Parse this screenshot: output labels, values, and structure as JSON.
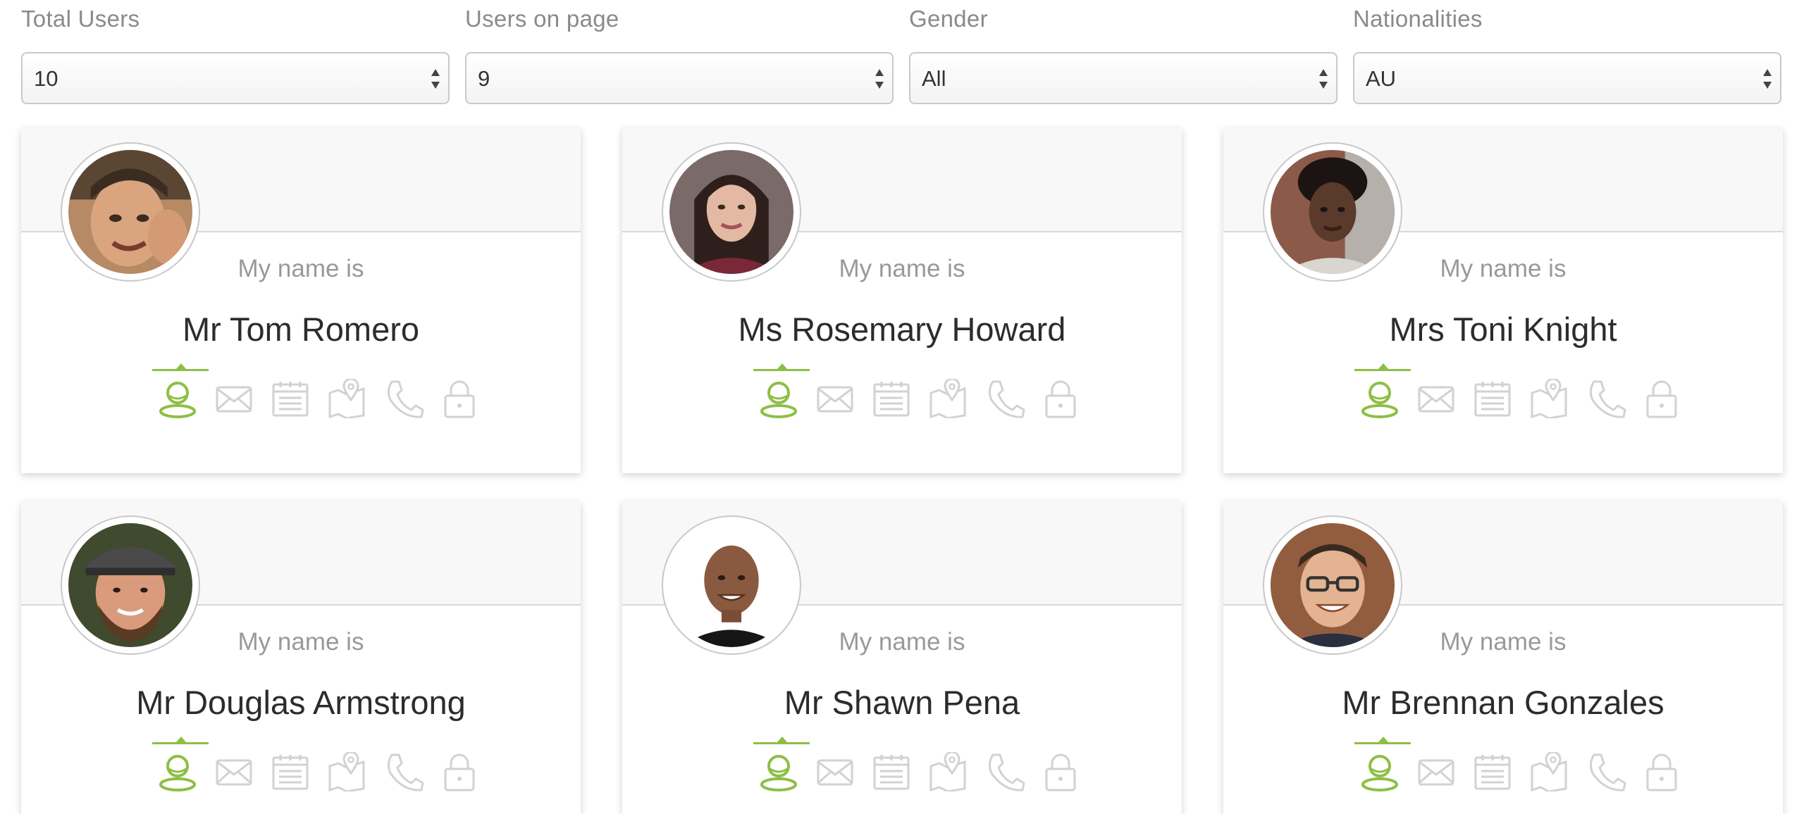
{
  "filters": [
    {
      "label": "Total Users",
      "value": "10"
    },
    {
      "label": "Users on page",
      "value": "9"
    },
    {
      "label": "Gender",
      "value": "All"
    },
    {
      "label": "Nationalities",
      "value": "AU"
    }
  ],
  "card_caption": "My name is",
  "users": [
    {
      "name": "Mr Tom Romero",
      "avatar": "man-avatar"
    },
    {
      "name": "Ms Rosemary Howard",
      "avatar": "woman-avatar"
    },
    {
      "name": "Mrs Toni Knight",
      "avatar": "woman-avatar"
    },
    {
      "name": "Mr Douglas Armstrong",
      "avatar": "man-avatar"
    },
    {
      "name": "Mr Shawn Pena",
      "avatar": "man-avatar"
    },
    {
      "name": "Mr Brennan Gonzales",
      "avatar": "man-avatar"
    }
  ],
  "card_icons": [
    "user-icon",
    "mail-icon",
    "calendar-icon",
    "map-icon",
    "phone-icon",
    "lock-icon"
  ],
  "colors": {
    "accent": "#8dbf45",
    "icon_inactive": "#d2d2d2",
    "label": "#8a8a8a",
    "name_text": "#2c2c2c"
  }
}
